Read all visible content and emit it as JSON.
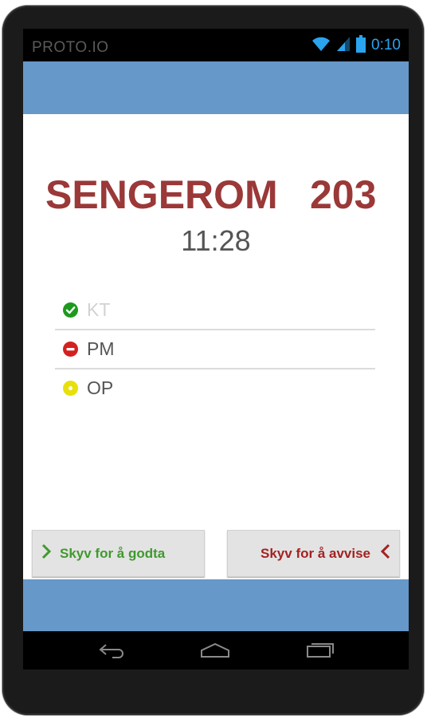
{
  "statusbar": {
    "brand": "PROTO.IO",
    "time": "0:10",
    "icons": [
      "wifi-icon",
      "signal-icon",
      "battery-icon"
    ],
    "accent_color": "#2aa4ee"
  },
  "room": {
    "title": "SENGEROM",
    "number": "203",
    "time": "11:28",
    "title_color": "#9b3838"
  },
  "items": [
    {
      "label": "KT",
      "status": "accepted",
      "icon": "check-circle-icon",
      "color": "#1c9a1c"
    },
    {
      "label": "PM",
      "status": "rejected",
      "icon": "minus-circle-icon",
      "color": "#d42020"
    },
    {
      "label": "OP",
      "status": "pending",
      "icon": "dot-circle-icon",
      "color": "#e8e00c"
    }
  ],
  "actions": {
    "accept_label": "Skyv for å godta",
    "reject_label": "Skyv for å avvise",
    "accept_color": "#3f9a2d",
    "reject_color": "#a32222"
  },
  "navbar": {
    "icons": [
      "back-icon",
      "home-icon",
      "recent-apps-icon"
    ]
  },
  "colors": {
    "bar": "#6698c9"
  }
}
